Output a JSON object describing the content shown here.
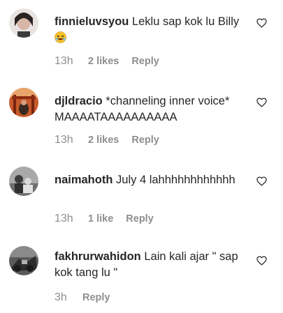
{
  "comments": [
    {
      "username": "finnieluvsyou",
      "text": "Leklu sap kok lu Billy",
      "emoji": "laughing-emoji",
      "time": "13h",
      "likes": "2 likes",
      "reply": "Reply"
    },
    {
      "username": "djldracio",
      "text": "*channeling inner voice* MAAAATAAAAAAAAAA",
      "time": "13h",
      "likes": "2 likes",
      "reply": "Reply"
    },
    {
      "username": "naimahoth",
      "text": "July 4 lahhhhhhhhhhhh",
      "time": "13h",
      "likes": "1 like",
      "reply": "Reply"
    },
    {
      "username": "fakhrurwahidon",
      "text": "Lain kali ajar \" sap kok tang lu \"",
      "time": "3h",
      "likes": "",
      "reply": "Reply"
    }
  ],
  "icons": {
    "heart": "heart-outline-icon",
    "emoji": "grinning-squinting-face-icon"
  },
  "colors": {
    "primary_text": "#262626",
    "secondary_text": "#8e8e8e"
  }
}
